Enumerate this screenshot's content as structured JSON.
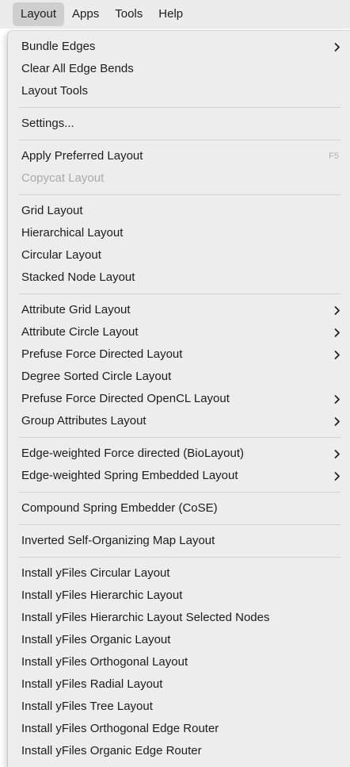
{
  "menubar": {
    "items": [
      {
        "label": "Layout",
        "active": true
      },
      {
        "label": "Apps"
      },
      {
        "label": "Tools"
      },
      {
        "label": "Help"
      }
    ]
  },
  "menu": {
    "groups": [
      [
        {
          "label": "Bundle Edges",
          "submenu": true
        },
        {
          "label": "Clear All Edge Bends"
        },
        {
          "label": "Layout Tools"
        }
      ],
      [
        {
          "label": "Settings..."
        }
      ],
      [
        {
          "label": "Apply Preferred Layout",
          "shortcut": "F5"
        },
        {
          "label": "Copycat Layout",
          "disabled": true
        }
      ],
      [
        {
          "label": "Grid Layout"
        },
        {
          "label": "Hierarchical Layout"
        },
        {
          "label": "Circular Layout"
        },
        {
          "label": "Stacked Node Layout"
        }
      ],
      [
        {
          "label": "Attribute Grid Layout",
          "submenu": true
        },
        {
          "label": "Attribute Circle Layout",
          "submenu": true
        },
        {
          "label": "Prefuse Force Directed Layout",
          "submenu": true
        },
        {
          "label": "Degree Sorted Circle Layout"
        },
        {
          "label": "Prefuse Force Directed OpenCL Layout",
          "submenu": true
        },
        {
          "label": "Group Attributes Layout",
          "submenu": true
        }
      ],
      [
        {
          "label": "Edge-weighted Force directed (BioLayout)",
          "submenu": true
        },
        {
          "label": "Edge-weighted Spring Embedded Layout",
          "submenu": true
        }
      ],
      [
        {
          "label": "Compound Spring Embedder (CoSE)"
        }
      ],
      [
        {
          "label": "Inverted Self-Organizing Map Layout"
        }
      ],
      [
        {
          "label": "Install yFiles Circular Layout"
        },
        {
          "label": "Install yFiles Hierarchic Layout"
        },
        {
          "label": "Install yFiles Hierarchic Layout Selected Nodes"
        },
        {
          "label": "Install yFiles Organic Layout"
        },
        {
          "label": "Install yFiles Orthogonal Layout"
        },
        {
          "label": "Install yFiles Radial Layout"
        },
        {
          "label": "Install yFiles Tree Layout"
        },
        {
          "label": "Install yFiles Orthogonal Edge Router"
        },
        {
          "label": "Install yFiles Organic Edge Router"
        }
      ]
    ]
  }
}
